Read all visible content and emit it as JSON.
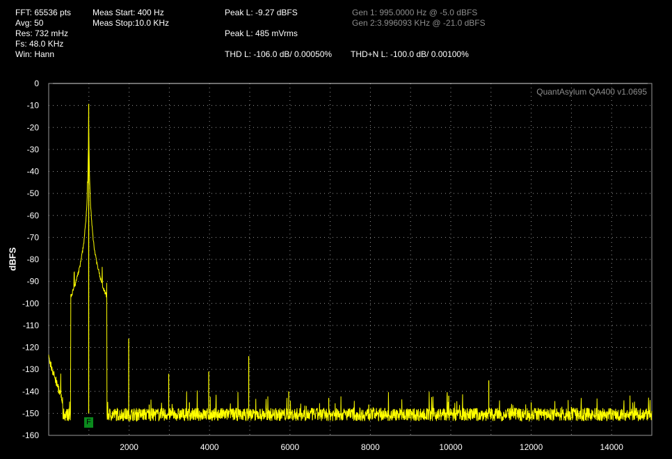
{
  "header": {
    "fft": "FFT: 65536 pts",
    "avg": "Avg: 50",
    "res": "Res: 732 mHz",
    "fs": "Fs: 48.0 KHz",
    "win": "Win: Hann",
    "meas_start": "Meas Start: 400 Hz",
    "meas_stop": "Meas Stop:10.0 KHz",
    "peak_dbfs": "Peak L: -9.27 dBFS",
    "peak_vrms": "Peak L: 485 mVrms",
    "thd": "THD L: -106.0 dB/ 0.00050%",
    "thdn": "THD+N L: -100.0 dB/ 0.00100%",
    "gen1": "Gen 1: 995.0000 Hz @ -5.0  dBFS",
    "gen2": "Gen 2:3.996093 KHz @ -21.0  dBFS"
  },
  "marker_label": "F",
  "colors": {
    "trace": "#ffff00",
    "grid": "#9a9a9a",
    "background": "#000000",
    "marker": "#0b8a1d",
    "watermark": "#8c8c8c"
  },
  "chart_data": {
    "type": "line",
    "watermark": "QuantAsylum QA400 v1.0695",
    "ylabel": "dBFS",
    "xlabel": "",
    "xlim": [
      0,
      15000
    ],
    "ylim": [
      -160,
      0
    ],
    "xticks": [
      2000,
      4000,
      6000,
      8000,
      10000,
      12000,
      14000
    ],
    "yticks": [
      0,
      -10,
      -20,
      -30,
      -40,
      -50,
      -60,
      -70,
      -80,
      -90,
      -100,
      -110,
      -120,
      -130,
      -140,
      -150,
      -160
    ],
    "grid": true,
    "reference_line_db": 0,
    "noise_floor_db": -150,
    "series": [
      {
        "peaks": [
          {
            "x": 995,
            "y": -9.27
          },
          {
            "x": 1990,
            "y": -116
          },
          {
            "x": 2500,
            "y": -146
          },
          {
            "x": 2985,
            "y": -132
          },
          {
            "x": 3500,
            "y": -145
          },
          {
            "x": 3980,
            "y": -131
          },
          {
            "x": 4975,
            "y": -124
          },
          {
            "x": 5970,
            "y": -140
          },
          {
            "x": 6965,
            "y": -143
          },
          {
            "x": 7960,
            "y": -146
          },
          {
            "x": 8955,
            "y": -148
          },
          {
            "x": 9950,
            "y": -142
          },
          {
            "x": 10945,
            "y": -135
          },
          {
            "x": 12000,
            "y": -145
          },
          {
            "x": 13000,
            "y": -147
          }
        ]
      }
    ]
  }
}
